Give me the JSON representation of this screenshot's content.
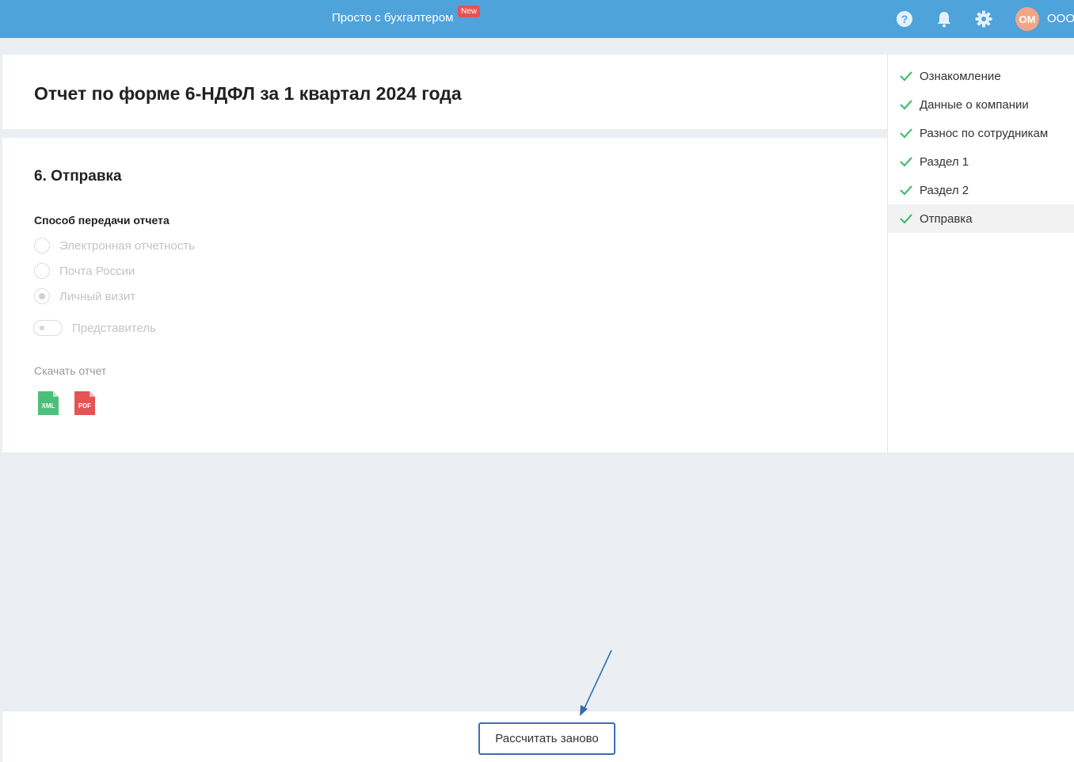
{
  "header": {
    "promo_text": "Просто с бухгалтером",
    "promo_badge": "New",
    "avatar_initials": "ОМ",
    "org_name": "ООО",
    "icons": [
      "help-icon",
      "bell-icon",
      "gear-icon"
    ],
    "color": "#4fa3db"
  },
  "page": {
    "title": "Отчет по форме 6-НДФЛ за 1 квартал 2024 года"
  },
  "section": {
    "title": "6. Отправка",
    "transfer_label": "Способ передачи отчета",
    "options": [
      {
        "label": "Электронная отчетность",
        "selected": false
      },
      {
        "label": "Почта России",
        "selected": false
      },
      {
        "label": "Личный визит",
        "selected": true
      }
    ],
    "representative_label": "Представитель",
    "representative_on": false,
    "download_label": "Скачать отчет",
    "files": [
      {
        "label": "XML",
        "color": "#4cc07a"
      },
      {
        "label": "PDF",
        "color": "#e55353"
      }
    ]
  },
  "sidebar": {
    "steps": [
      {
        "label": "Ознакомление",
        "done": true
      },
      {
        "label": "Данные о компании",
        "done": true
      },
      {
        "label": "Разнос по сотрудникам",
        "done": true
      },
      {
        "label": "Раздел 1",
        "done": true
      },
      {
        "label": "Раздел 2",
        "done": true
      },
      {
        "label": "Отправка",
        "done": true,
        "active": true
      }
    ],
    "check_color": "#3fbf6e"
  },
  "footer": {
    "recalc_label": "Рассчитать заново"
  }
}
